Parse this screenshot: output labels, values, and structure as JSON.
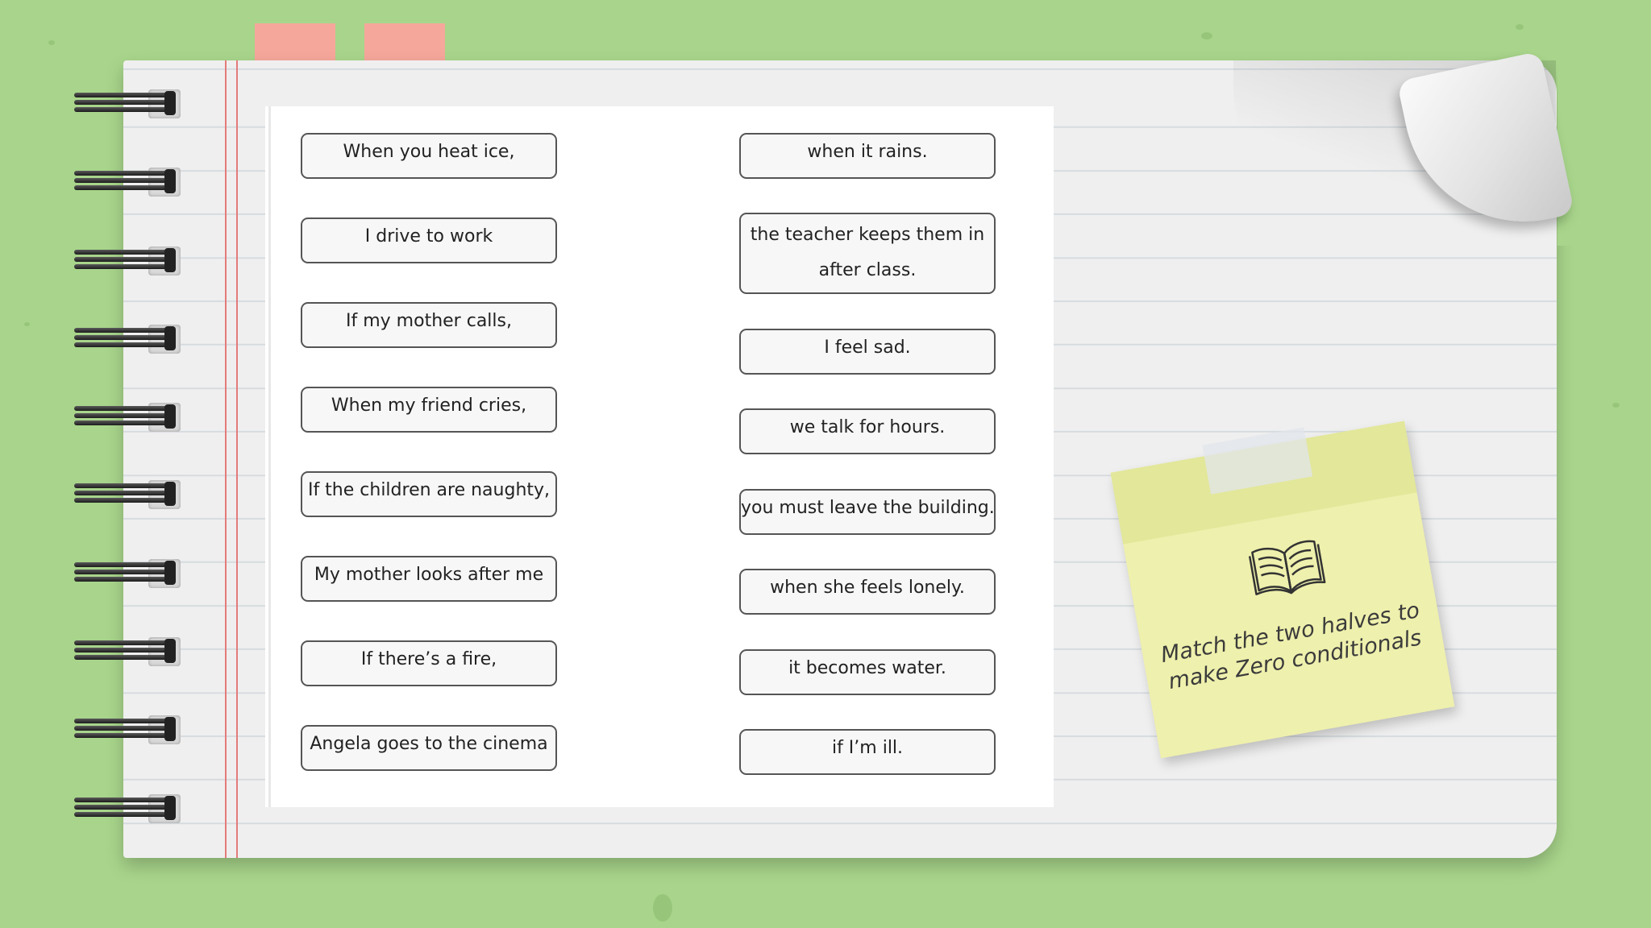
{
  "left_items": [
    "When you heat ice,",
    "I drive to work",
    "If my mother calls,",
    "When my friend cries,",
    "If the children are naughty,",
    "My mother looks after me",
    "If there’s a fire,",
    "Angela goes to the cinema"
  ],
  "right_items": [
    "when it rains.",
    "the teacher keeps them in after class.",
    "I feel sad.",
    "we talk for hours.",
    "you must leave the building.",
    "when she feels lonely.",
    "it becomes water.",
    "if I’m ill."
  ],
  "sticky_note": {
    "line1": "Match the two halves to",
    "line2": "make Zero conditionals",
    "icon": "open-book-icon"
  },
  "colors": {
    "background": "#a8d58b",
    "page": "#efefef",
    "tab": "#f6a79b",
    "margin_line": "#e57a7a",
    "sticky": "#eef0ad"
  }
}
